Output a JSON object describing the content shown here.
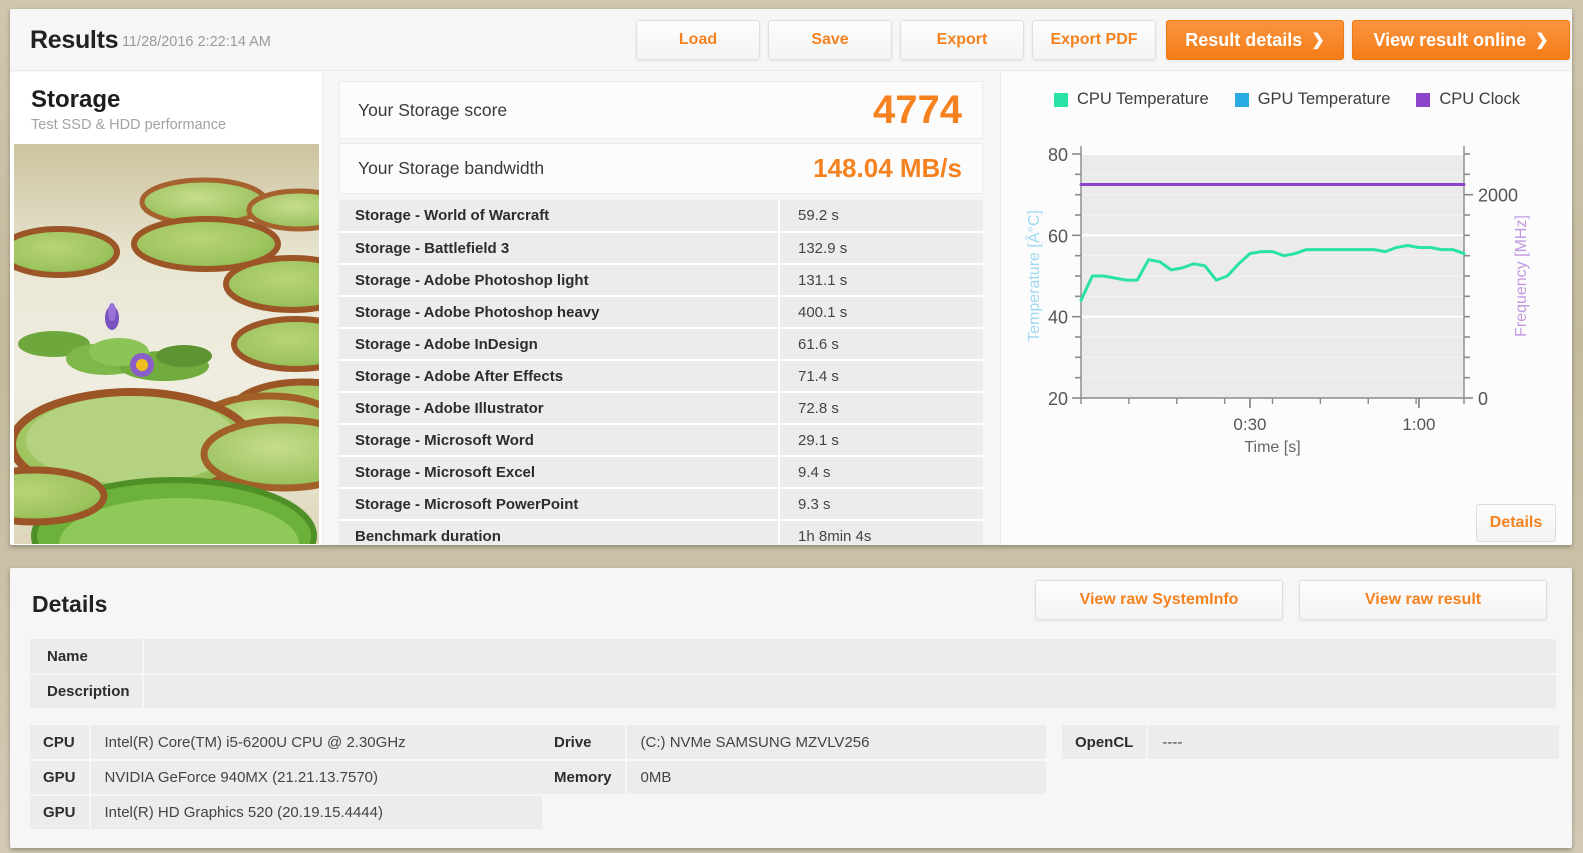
{
  "header": {
    "title": "Results",
    "timestamp": "11/28/2016 2:22:14 AM",
    "buttons": {
      "load": "Load",
      "save": "Save",
      "export": "Export",
      "export_pdf": "Export PDF",
      "result_details": "Result details",
      "view_result_online": "View result online",
      "chevron": "❯"
    }
  },
  "benchmark": {
    "name": "Storage",
    "subtitle": "Test SSD & HDD performance",
    "image_alt": "lily-pad-pond-photo"
  },
  "scores": {
    "score_label": "Your Storage score",
    "score_value": "4774",
    "bandwidth_label": "Your Storage bandwidth",
    "bandwidth_value": "148.04 MB/s"
  },
  "results_table": {
    "rows": [
      {
        "name": "Storage - World of Warcraft",
        "value": "59.2 s"
      },
      {
        "name": "Storage - Battlefield 3",
        "value": "132.9 s"
      },
      {
        "name": "Storage - Adobe Photoshop light",
        "value": "131.1 s"
      },
      {
        "name": "Storage - Adobe Photoshop heavy",
        "value": "400.1 s"
      },
      {
        "name": "Storage - Adobe InDesign",
        "value": "61.6 s"
      },
      {
        "name": "Storage - Adobe After Effects",
        "value": "71.4 s"
      },
      {
        "name": "Storage - Adobe Illustrator",
        "value": "72.8 s"
      },
      {
        "name": "Storage - Microsoft Word",
        "value": "29.1 s"
      },
      {
        "name": "Storage - Microsoft Excel",
        "value": "9.4 s"
      },
      {
        "name": "Storage - Microsoft PowerPoint",
        "value": "9.3 s"
      },
      {
        "name": "Benchmark duration",
        "value": "1h 8min 4s"
      }
    ]
  },
  "chart_panel": {
    "details_button": "Details"
  },
  "chart_data": {
    "type": "line",
    "title": "",
    "xlabel": "Time [s]",
    "ylabel": "Temperature [Â°C]",
    "y2label": "Frequency [MHz]",
    "xlim": [
      0,
      68
    ],
    "ylim": [
      20,
      80
    ],
    "y2lim": [
      0,
      2400
    ],
    "xticks": [
      "0:30",
      "1:00"
    ],
    "xtick_values": [
      30,
      60
    ],
    "yticks": [
      20,
      40,
      60,
      80
    ],
    "y2ticks": [
      0,
      2000
    ],
    "grid": true,
    "legend_position": "top-center",
    "plot_bg": "#ebebeb",
    "series": [
      {
        "name": "CPU Temperature",
        "color": "#2ae2a8",
        "axis": "left",
        "x": [
          0,
          2,
          4,
          6,
          8,
          10,
          12,
          14,
          16,
          18,
          20,
          22,
          24,
          26,
          28,
          30,
          32,
          34,
          36,
          38,
          40,
          42,
          44,
          46,
          48,
          50,
          52,
          54,
          56,
          58,
          60,
          62,
          64,
          66,
          68
        ],
        "values": [
          44,
          50,
          50,
          49.5,
          49,
          49,
          54,
          53.5,
          51.5,
          52,
          53,
          52.5,
          49,
          50,
          53,
          55.5,
          56,
          56,
          55,
          55.5,
          56.5,
          56.5,
          56.5,
          56.5,
          56.5,
          56.5,
          56.5,
          56,
          57,
          57.5,
          57,
          57,
          56.5,
          56.5,
          55.5
        ]
      },
      {
        "name": "GPU Temperature",
        "color": "#29ace4",
        "axis": "left",
        "x": [],
        "values": []
      },
      {
        "name": "CPU Clock",
        "color": "#8e44c8",
        "axis": "right",
        "x": [
          0,
          10,
          20,
          30,
          40,
          50,
          60,
          68
        ],
        "values": [
          2100,
          2100,
          2100,
          2100,
          2100,
          2100,
          2100,
          2100
        ]
      }
    ]
  },
  "details": {
    "title": "Details",
    "view_raw_systeminfo": "View raw SystemInfo",
    "view_raw_result": "View raw result",
    "name_label": "Name",
    "name_value": "",
    "description_label": "Description",
    "description_value": "",
    "system_left": [
      {
        "key": "CPU",
        "value": "Intel(R) Core(TM) i5-6200U CPU @ 2.30GHz"
      },
      {
        "key": "GPU",
        "value": "NVIDIA GeForce 940MX (21.21.13.7570)"
      },
      {
        "key": "GPU",
        "value": "Intel(R) HD Graphics 520 (20.19.15.4444)"
      }
    ],
    "system_mid": [
      {
        "key": "Drive",
        "value": "(C:) NVMe SAMSUNG MZVLV256"
      },
      {
        "key": "Memory",
        "value": "0MB"
      }
    ],
    "system_right": [
      {
        "key": "OpenCL",
        "value": "----"
      }
    ]
  },
  "colors": {
    "accent_orange": "#f5821f",
    "cpu_temp": "#2ae2a8",
    "gpu_temp": "#29ace4",
    "cpu_clock": "#8e44c8",
    "panel_bg": "#f6f6f6",
    "row_bg": "#ececec"
  }
}
